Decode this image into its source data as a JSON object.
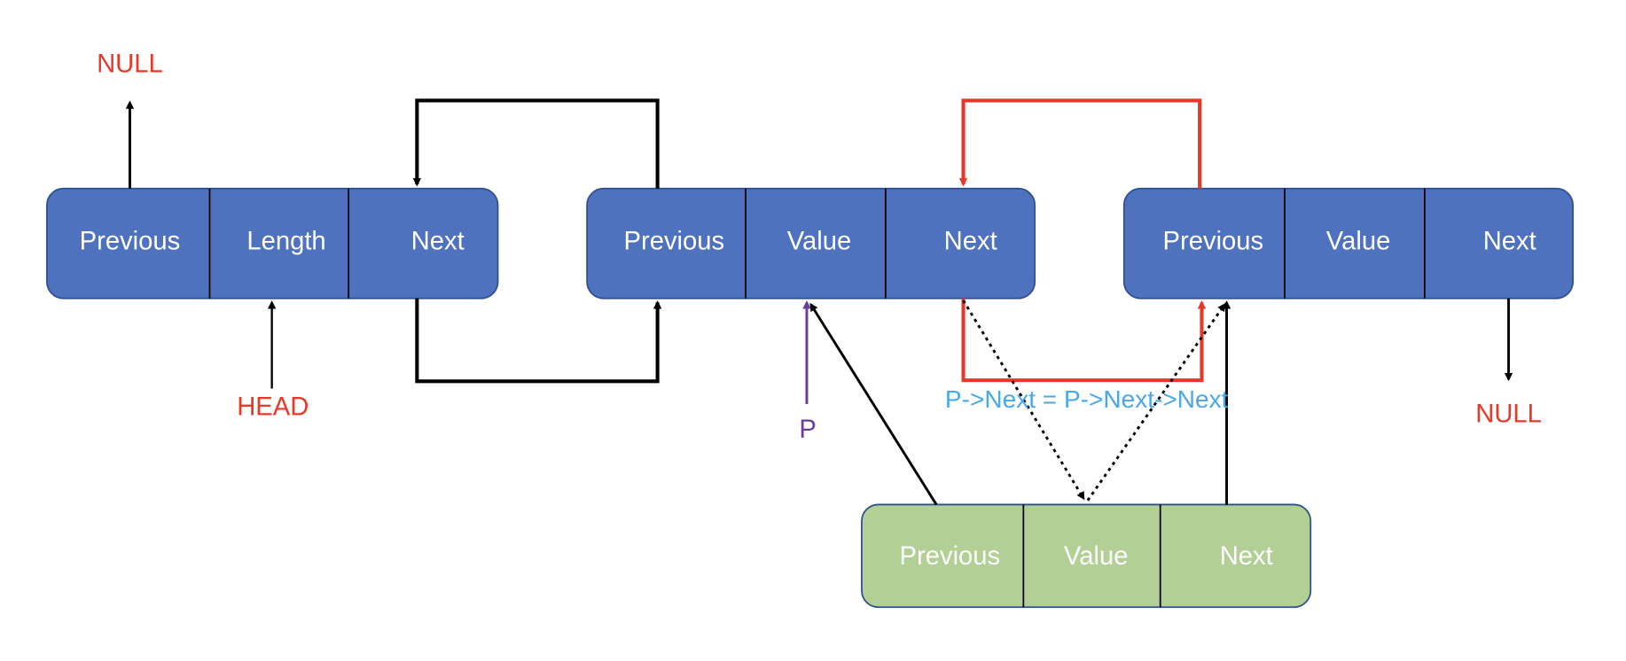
{
  "colors": {
    "node_fill": "#4f72bf",
    "new_node_fill": "#b2cf96",
    "null_text": "#e8382a",
    "pointer_p": "#6a3d9a",
    "annotation": "#4aa8e8",
    "red_link": "#e8382a"
  },
  "header_node": {
    "fields": [
      "Previous",
      "Length",
      "Next"
    ]
  },
  "node_a": {
    "fields": [
      "Previous",
      "Value",
      "Next"
    ]
  },
  "node_b": {
    "fields": [
      "Previous",
      "Value",
      "Next"
    ]
  },
  "new_node": {
    "fields": [
      "Previous",
      "Value",
      "Next"
    ]
  },
  "labels": {
    "null_top": "NULL",
    "head": "HEAD",
    "p": "P",
    "null_bottom": "NULL",
    "annotation": "P->Next = P->Next->Next"
  }
}
